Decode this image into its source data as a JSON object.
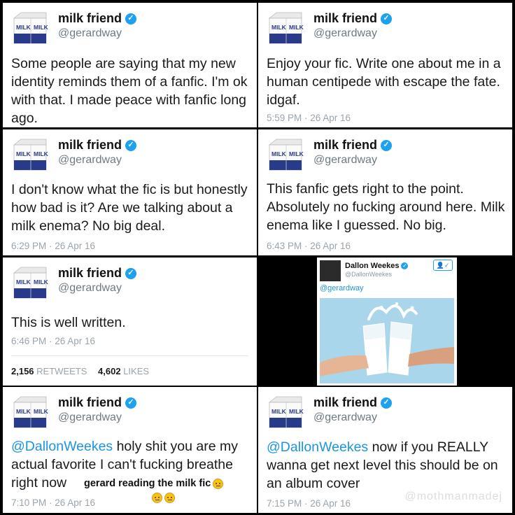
{
  "account": {
    "name": "milk friend",
    "handle": "@gerardway",
    "avatar_label": "MILK MILK"
  },
  "tweets": [
    {
      "text": "Some people are saying that my new identity reminds them of a fanfic. I'm ok with that. I made peace with fanfic long ago.",
      "timestamp": ""
    },
    {
      "text": "Enjoy your fic. Write one about me in a human centipede with escape the fate. idgaf.",
      "timestamp": "5:59 PM · 26 Apr 16"
    },
    {
      "text": "I don't know what the fic is but honestly how bad is it? Are we talking about a milk enema? No big deal.",
      "timestamp": "6:29 PM · 26 Apr 16"
    },
    {
      "text": "This fanfic gets right to the point. Absolutely no fucking around here. Milk enema like I guessed. No big.",
      "timestamp": "6:43 PM · 26 Apr 16"
    },
    {
      "text": "This is well written.",
      "timestamp": "6:46 PM · 26 Apr 16",
      "retweets_count": "2,156",
      "retweets_label": "RETWEETS",
      "likes_count": "4,602",
      "likes_label": "LIKES"
    },
    {
      "mention": "@DallonWeekes",
      "text": " holy shit you are my actual favorite I can't fucking breathe right now",
      "timestamp": "7:10 PM · 26 Apr 16",
      "caption": "gerard reading the milk fic"
    },
    {
      "mention": "@DallonWeekes",
      "text": " now if you REALLY wanna get next level this should be on an album cover",
      "timestamp": "7:15 PM · 26 Apr 16",
      "watermark": "@mothmanmadej"
    }
  ],
  "embedded_reply": {
    "name": "Dallon Weekes",
    "handle": "@DallonWeekes",
    "mention": "@gerardway",
    "photo_description_icon": "milk-splash-photo"
  },
  "colors": {
    "link": "#1b95e0",
    "verified": "#1da1f2",
    "timestamp": "#9aa4ad",
    "carton_blue": "#2a3a8a"
  }
}
